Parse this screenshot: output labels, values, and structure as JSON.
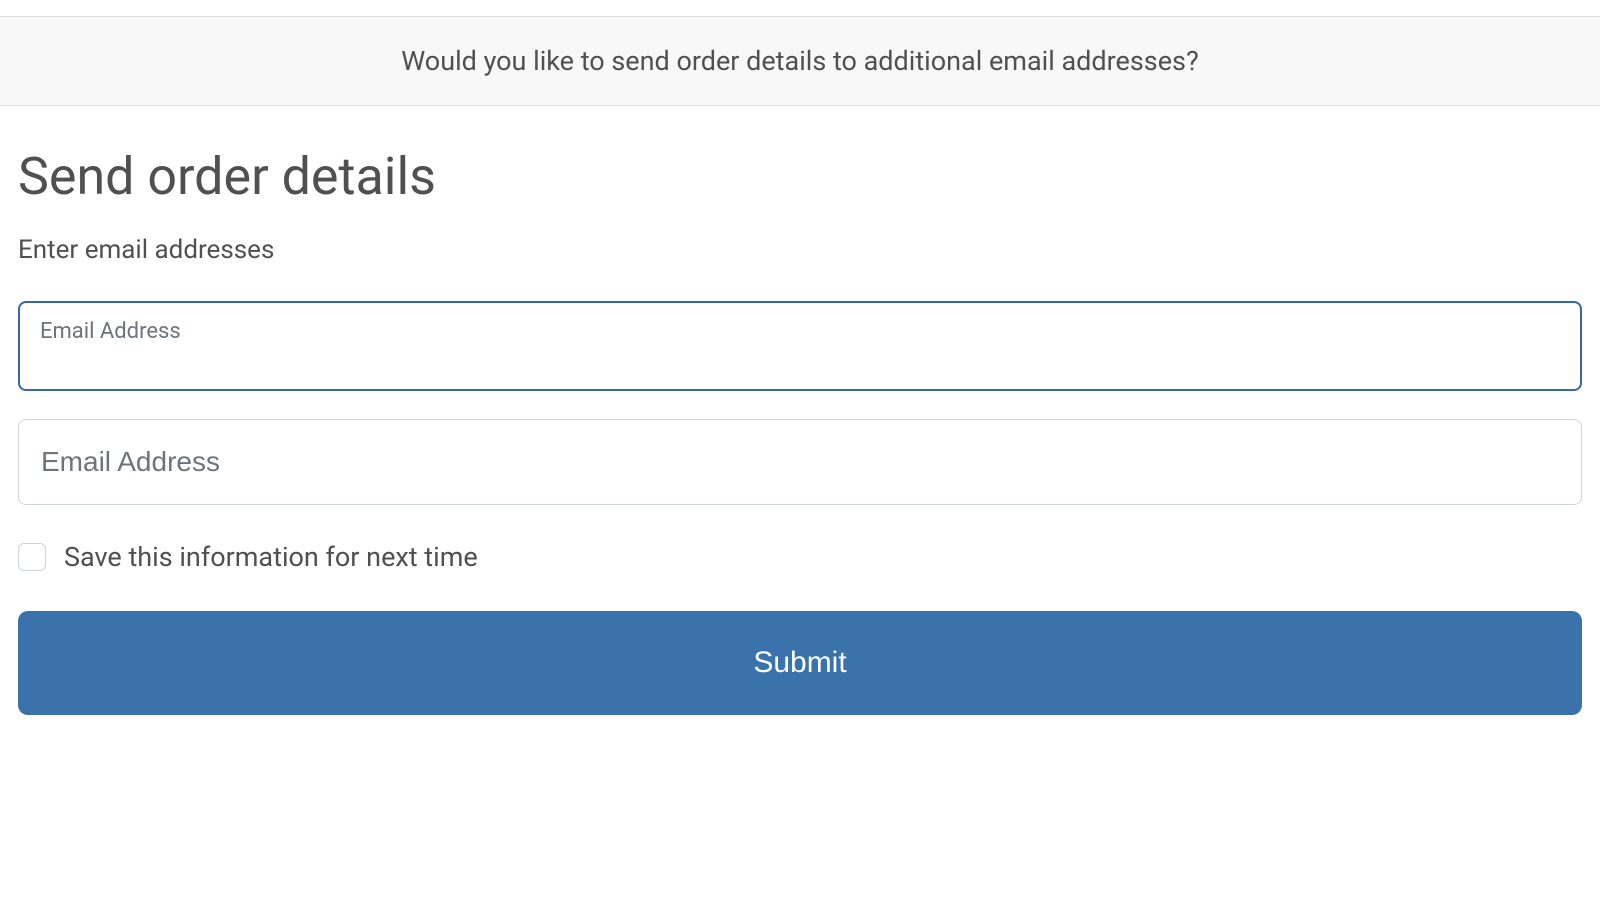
{
  "banner": {
    "text": "Would you like to send order details to additional email addresses?"
  },
  "header": {
    "title": "Send order details",
    "sectionLabel": "Enter email addresses"
  },
  "fields": {
    "email1": {
      "label": "Email Address",
      "value": ""
    },
    "email2": {
      "placeholder": "Email Address",
      "value": ""
    }
  },
  "checkbox": {
    "label": "Save this information for next time",
    "checked": false
  },
  "actions": {
    "submit": "Submit"
  }
}
